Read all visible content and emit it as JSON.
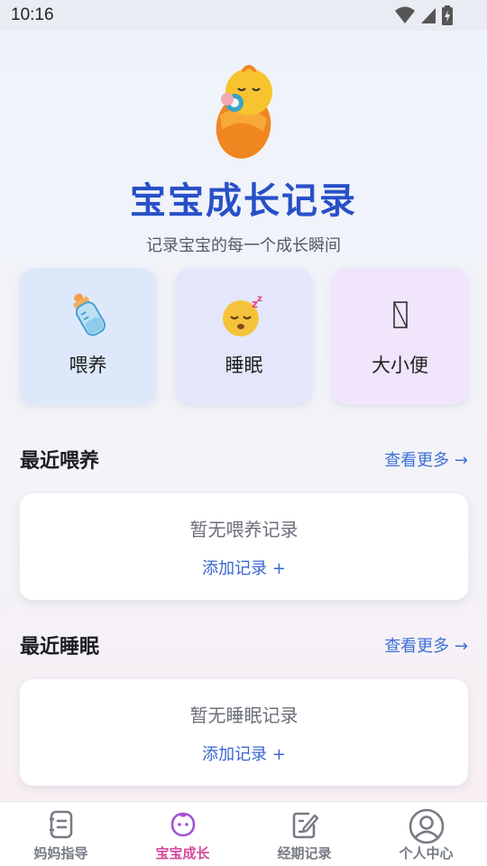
{
  "status_bar": {
    "time": "10:16"
  },
  "hero": {
    "title": "宝宝成长记录",
    "subtitle": "记录宝宝的每一个成长瞬间"
  },
  "quick_cards": [
    {
      "label": "喂养",
      "icon": "baby-bottle-icon",
      "bg": "#dde9fb"
    },
    {
      "label": "睡眠",
      "icon": "sleeping-face-icon",
      "bg": "#e4e7fb"
    },
    {
      "label": "大小便",
      "icon": "placeholder-glyph-icon",
      "bg": "#f0e5fb"
    }
  ],
  "sections": [
    {
      "title": "最近喂养",
      "more": "查看更多 →",
      "empty_text": "暂无喂养记录",
      "add_label": "添加记录 +"
    },
    {
      "title": "最近睡眠",
      "more": "查看更多 →",
      "empty_text": "暂无睡眠记录",
      "add_label": "添加记录 +"
    }
  ],
  "tabbar": {
    "active_color": "#d64a9a",
    "items": [
      {
        "label": "妈妈指导",
        "icon": "guide-book-icon",
        "active": false
      },
      {
        "label": "宝宝成长",
        "icon": "baby-face-icon",
        "active": true
      },
      {
        "label": "经期记录",
        "icon": "edit-note-icon",
        "active": false
      },
      {
        "label": "个人中心",
        "icon": "user-profile-icon",
        "active": false
      }
    ]
  },
  "colors": {
    "brand_blue": "#2850c8",
    "link_blue": "#3f6fd8"
  }
}
